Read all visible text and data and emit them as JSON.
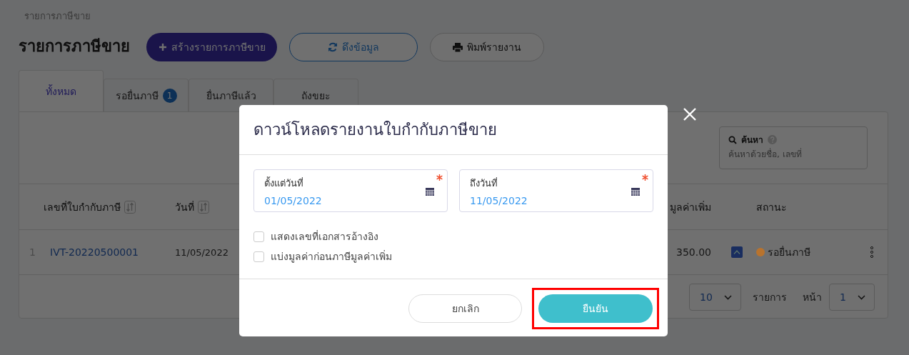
{
  "breadcrumb": "รายการภาษีขาย",
  "page_title": "รายการภาษีขาย",
  "actions": [
    {
      "kind": "create",
      "label": "สร้างรายการภาษีขาย"
    },
    {
      "kind": "refresh",
      "label": "ดึงข้อมูล"
    },
    {
      "kind": "print",
      "label": "พิมพ์รายงาน"
    }
  ],
  "tabs": [
    {
      "label": "ทั้งหมด",
      "selected": true
    },
    {
      "label": "รอยื่นภาษี",
      "badge": "1",
      "selected": false
    },
    {
      "label": "ยื่นภาษีแล้ว",
      "selected": false
    },
    {
      "label": "ถังขยะ",
      "selected": false
    }
  ],
  "search": {
    "label": "ค้นหา",
    "placeholder": "ค้นหาด้วยชื่อ, เลขที่"
  },
  "table": {
    "columns": [
      {
        "label": "เลขที่ใบกำกับภาษี",
        "sortable": true
      },
      {
        "label": "วันที่",
        "sortable": true
      },
      {
        "label": "มูลค่าเพิ่ม",
        "sortable": false
      },
      {
        "label": "สถานะ",
        "sortable": false
      }
    ],
    "rows": [
      {
        "index": "1",
        "number": "IVT-20220500001",
        "date": "11/05/2022",
        "amount": "350.00",
        "status": "รอยื่นภาษี",
        "color": "#b8732e"
      }
    ]
  },
  "pagination": {
    "page_size": "10",
    "unit": "รายการ",
    "page_label": "หน้า",
    "page": "1"
  },
  "dialog": {
    "title": "ดาวน์โหลดรายงานใบกำกับภาษีขาย",
    "fields": [
      {
        "label": "ตั้งแต่วันที่",
        "value": "01/05/2022",
        "required": true
      },
      {
        "label": "ถึงวันที่",
        "value": "11/05/2022",
        "required": true
      }
    ],
    "options": [
      {
        "label": "แสดงเลขที่เอกสารอ้างอิง",
        "checked": false
      },
      {
        "label": "แบ่งมูลค่าก่อนภาษีมูลค่าเพิ่ม",
        "checked": false
      }
    ],
    "buttons": [
      {
        "kind": "cancel",
        "label": "ยกเลิก",
        "highlighted": false
      },
      {
        "kind": "confirm",
        "label": "ยืนยัน",
        "highlighted": true
      }
    ]
  }
}
